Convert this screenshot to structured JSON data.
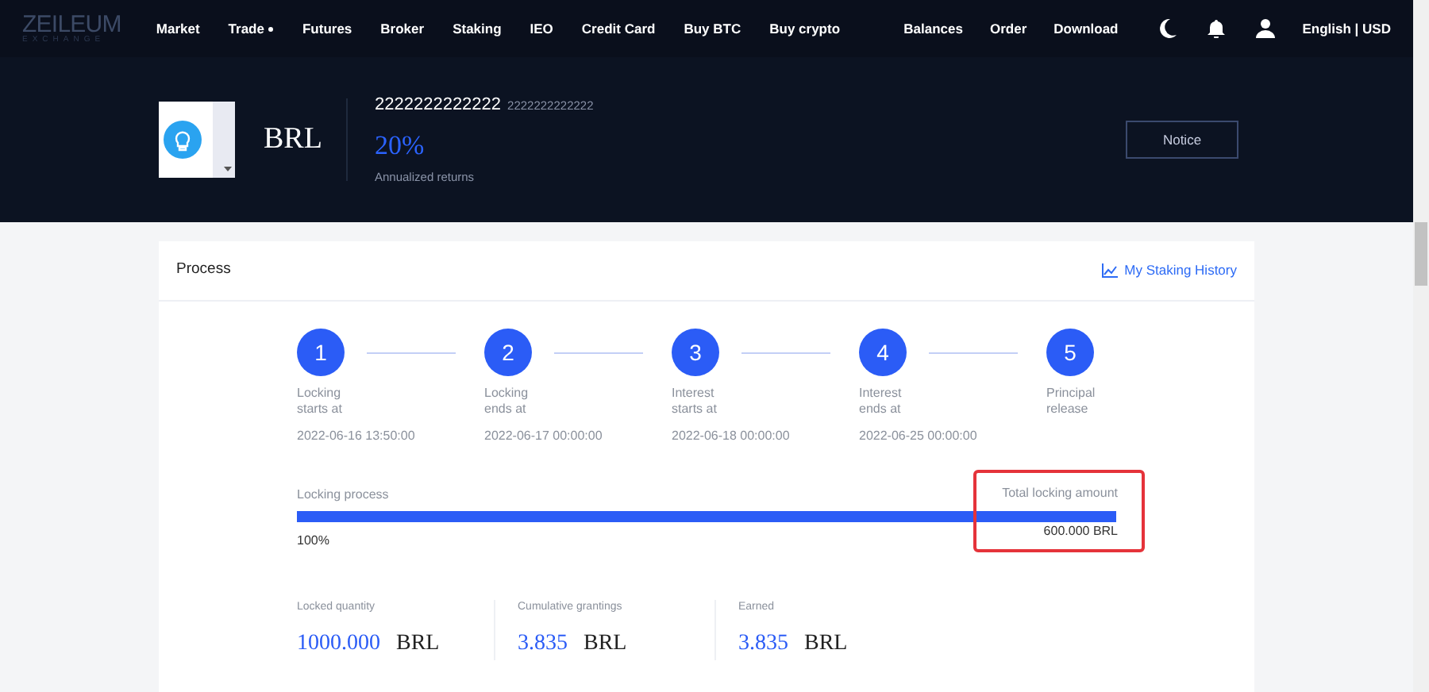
{
  "nav": {
    "logo": "ZEILEUM",
    "logo_sub": "EXCHANGE",
    "left": [
      {
        "label": "Market",
        "dropdown": false
      },
      {
        "label": "Trade",
        "dropdown": true
      },
      {
        "label": "Futures",
        "dropdown": false
      },
      {
        "label": "Broker",
        "dropdown": false
      },
      {
        "label": "Staking",
        "dropdown": false
      },
      {
        "label": "IEO",
        "dropdown": false
      },
      {
        "label": "Credit Card",
        "dropdown": false
      },
      {
        "label": "Buy BTC",
        "dropdown": false
      },
      {
        "label": "Buy crypto",
        "dropdown": false
      }
    ],
    "right": [
      "Balances",
      "Order",
      "Download"
    ],
    "locale": "English | USD"
  },
  "header": {
    "coin": "BRL",
    "title": "2222222222222",
    "subtitle": "2222222222222",
    "rate": "20%",
    "rate_label": "Annualized returns",
    "button": "Notice"
  },
  "process": {
    "title": "Process",
    "history_link": "My Staking History",
    "steps": [
      {
        "number": "1",
        "line1": "Locking",
        "line2": "starts at",
        "date": "2022-06-16 13:50:00"
      },
      {
        "number": "2",
        "line1": "Locking",
        "line2": "ends at",
        "date": "2022-06-17 00:00:00"
      },
      {
        "number": "3",
        "line1": "Interest",
        "line2": "starts at",
        "date": "2022-06-18 00:00:00"
      },
      {
        "number": "4",
        "line1": "Interest",
        "line2": "ends at",
        "date": "2022-06-25 00:00:00"
      },
      {
        "number": "5",
        "line1": "Principal",
        "line2": "release"
      }
    ],
    "progress": {
      "label": "Locking process",
      "level": 1,
      "percent": "100%",
      "total_label": "Total locking amount",
      "total": "600.000 BRL",
      "highlighted": true
    },
    "stats": [
      {
        "label": "Locked quantity",
        "value": "1000.000",
        "unit": "BRL"
      },
      {
        "label": "Cumulative grantings",
        "value": "3.835",
        "unit": "BRL"
      },
      {
        "label": "Earned",
        "value": "3.835",
        "unit": "BRL"
      }
    ]
  }
}
